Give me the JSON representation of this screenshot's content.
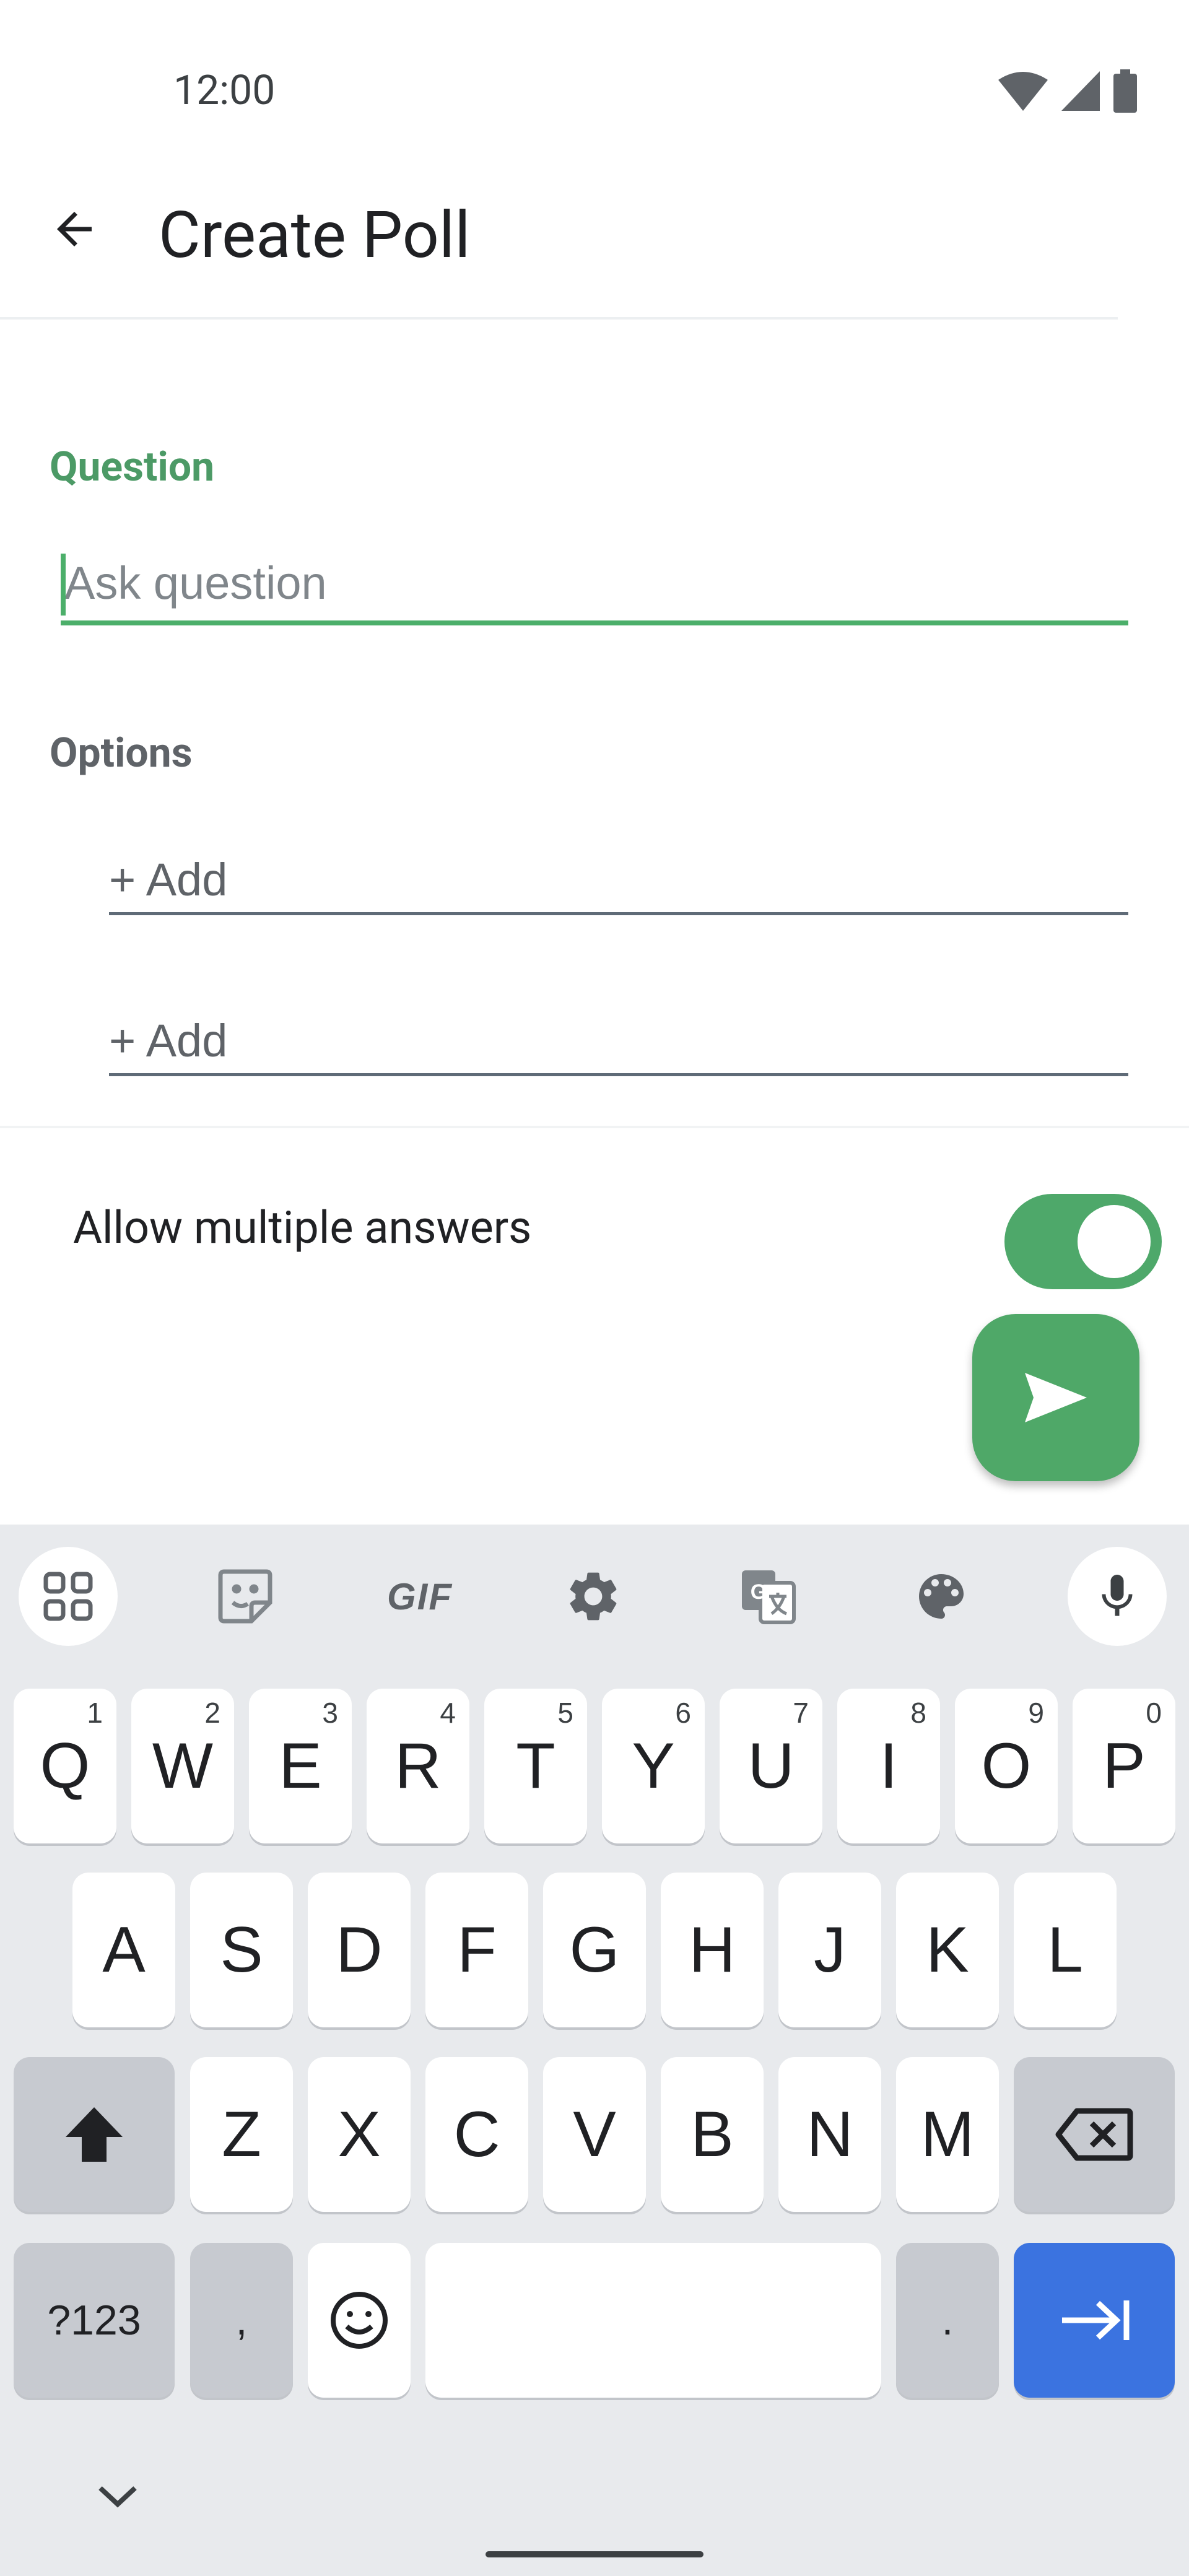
{
  "status_bar": {
    "time": "12:00"
  },
  "app_bar": {
    "title": "Create Poll"
  },
  "form": {
    "question_label": "Question",
    "question_placeholder": "Ask question",
    "question_value": "",
    "options_label": "Options",
    "options": [
      {
        "placeholder": "+ Add",
        "value": ""
      },
      {
        "placeholder": "+ Add",
        "value": ""
      }
    ],
    "allow_multiple_label": "Allow multiple answers",
    "allow_multiple_on": true
  },
  "colors": {
    "accent": "#4caf6a",
    "fab": "#4fa868",
    "enter_key": "#3b73e0",
    "keyboard_bg": "#e8eaed"
  },
  "keyboard": {
    "toolbar": {
      "gif_label": "GIF"
    },
    "row1": [
      {
        "label": "Q",
        "hint": "1"
      },
      {
        "label": "W",
        "hint": "2"
      },
      {
        "label": "E",
        "hint": "3"
      },
      {
        "label": "R",
        "hint": "4"
      },
      {
        "label": "T",
        "hint": "5"
      },
      {
        "label": "Y",
        "hint": "6"
      },
      {
        "label": "U",
        "hint": "7"
      },
      {
        "label": "I",
        "hint": "8"
      },
      {
        "label": "O",
        "hint": "9"
      },
      {
        "label": "P",
        "hint": "0"
      }
    ],
    "row2": [
      "A",
      "S",
      "D",
      "F",
      "G",
      "H",
      "J",
      "K",
      "L"
    ],
    "row3": [
      "Z",
      "X",
      "C",
      "V",
      "B",
      "N",
      "M"
    ],
    "symbols_label": "?123",
    "comma": ",",
    "period": "."
  }
}
